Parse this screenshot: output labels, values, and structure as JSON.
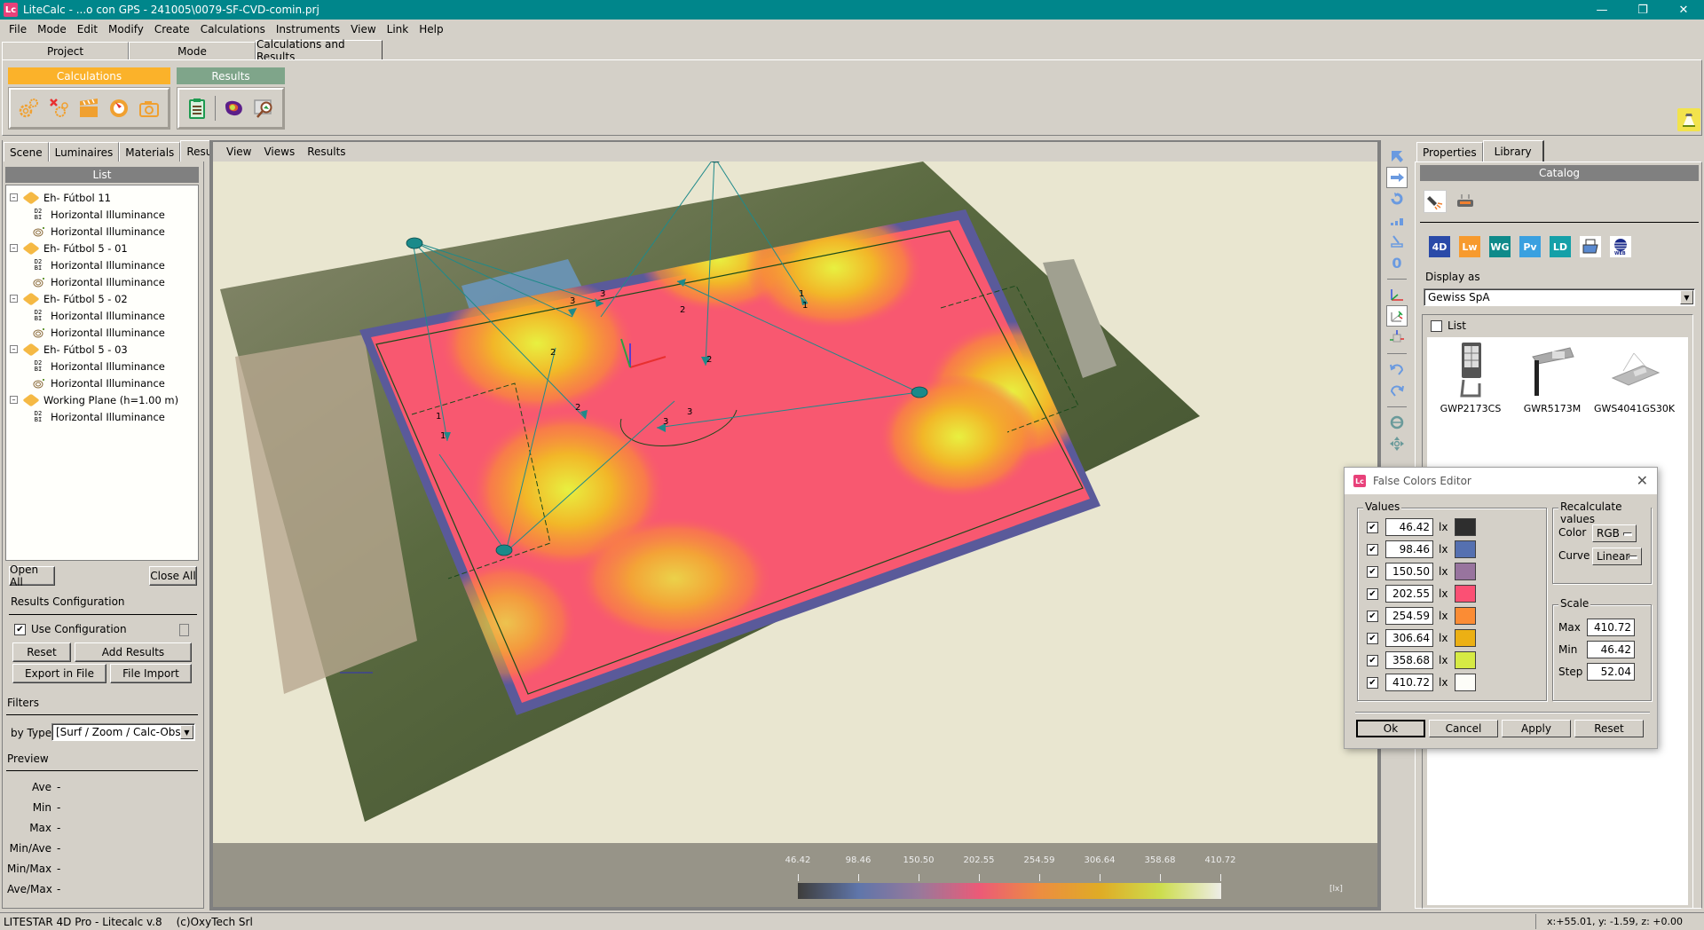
{
  "window": {
    "title": "LiteCalc - ...o con GPS - 241005\\0079-SF-CVD-comin.prj",
    "app_icon": "Lc",
    "controls": [
      "minimize",
      "restore",
      "close"
    ]
  },
  "menubar": [
    "File",
    "Mode",
    "Edit",
    "Modify",
    "Create",
    "Calculations",
    "Instruments",
    "View",
    "Link",
    "Help"
  ],
  "top_tabs": [
    {
      "label": "Project",
      "active": false
    },
    {
      "label": "Mode",
      "active": false
    },
    {
      "label": "Calculations and Results",
      "active": true
    }
  ],
  "ribbon": {
    "groups": [
      {
        "title": "Calculations",
        "color": "#fbb22a",
        "icons": [
          "calculate-gears-icon",
          "delete-calculation-icon",
          "clapperboard-icon",
          "compass-icon",
          "camera-icon"
        ]
      },
      {
        "title": "Results",
        "color": "#7fa58a",
        "icons": [
          "report-clipboard-icon",
          "false-color-icon",
          "image-zoom-icon"
        ]
      }
    ]
  },
  "left_panel": {
    "tabs": [
      {
        "label": "Scene",
        "active": false
      },
      {
        "label": "Luminaires",
        "active": false
      },
      {
        "label": "Materials",
        "active": false
      },
      {
        "label": "Results",
        "active": true
      }
    ],
    "list_header": "List",
    "tree": [
      {
        "label": "Eh- Fútbol 11",
        "children": [
          "Horizontal Illuminance",
          "Horizontal Illuminance"
        ]
      },
      {
        "label": "Eh- Fútbol 5 - 01",
        "children": [
          "Horizontal Illuminance",
          "Horizontal Illuminance"
        ]
      },
      {
        "label": "Eh- Fútbol 5 - 02",
        "children": [
          "Horizontal Illuminance",
          "Horizontal Illuminance"
        ]
      },
      {
        "label": "Eh- Fútbol 5 - 03",
        "children": [
          "Horizontal Illuminance",
          "Horizontal Illuminance"
        ]
      },
      {
        "label": "Working Plane (h=1.00 m)",
        "children": [
          "Horizontal Illuminance"
        ]
      }
    ],
    "open_all": "Open All",
    "close_all": "Close All",
    "results_config_label": "Results Configuration",
    "use_configuration": {
      "label": "Use Configuration",
      "checked": true
    },
    "reset": "Reset",
    "add_results": "Add Results",
    "export_in_file": "Export in File",
    "file_import": "File Import",
    "filters_label": "Filters",
    "by_type_label": "by Type",
    "by_type_value": "[Surf / Zoom / Calc-Obs]",
    "preview_label": "Preview",
    "preview": [
      {
        "label": "Ave",
        "value": "-"
      },
      {
        "label": "Min",
        "value": "-"
      },
      {
        "label": "Max",
        "value": "-"
      },
      {
        "label": "Min/Ave",
        "value": "-"
      },
      {
        "label": "Min/Max",
        "value": "-"
      },
      {
        "label": "Ave/Max",
        "value": "-"
      }
    ]
  },
  "viewport": {
    "menu": [
      "View",
      "Views",
      "Results"
    ],
    "aim_labels": [
      "3",
      "3",
      "2",
      "2",
      "2",
      "2",
      "3",
      "3",
      "1",
      "1",
      "1",
      "1"
    ],
    "legend": {
      "ticks": [
        "46.42",
        "98.46",
        "150.50",
        "202.55",
        "254.59",
        "306.64",
        "358.68",
        "410.72"
      ],
      "unit": "[lx]"
    }
  },
  "vertical_toolbar": [
    "select-arrow-icon",
    "move-icon",
    "rotate-icon",
    "scale-icon",
    "aim-icon",
    "zero-icon",
    "axes-icon",
    "view-axes-icon",
    "cube-axes-icon",
    "undo-icon",
    "redo-icon",
    "orbit-icon",
    "pan-icon"
  ],
  "right_panel": {
    "tabs": [
      {
        "label": "Properties",
        "active": false
      },
      {
        "label": "Library",
        "active": true
      }
    ],
    "catalog_header": "Catalog",
    "sources": [
      {
        "label": "4D",
        "bg": "#2a4aa8"
      },
      {
        "label": "Lw",
        "bg": "#f79a2e"
      },
      {
        "label": "WG",
        "bg": "#0e8a8a"
      },
      {
        "label": "Pv",
        "bg": "#3aa0e0"
      },
      {
        "label": "LD",
        "bg": "#15a0a8"
      }
    ],
    "display_as_label": "Display as",
    "display_as_value": "Gewiss SpA",
    "list_checkbox": {
      "label": "List",
      "checked": false
    },
    "luminaires": [
      "GWP2173CS",
      "GWR5173M",
      "GWS4041GS30K"
    ]
  },
  "false_colors_dialog": {
    "title": "False Colors Editor",
    "values_label": "Values",
    "unit": "lx",
    "rows": [
      {
        "checked": true,
        "value": "46.42",
        "color": "#2e2e2e"
      },
      {
        "checked": true,
        "value": "98.46",
        "color": "#5570b0"
      },
      {
        "checked": true,
        "value": "150.50",
        "color": "#98749e"
      },
      {
        "checked": true,
        "value": "202.55",
        "color": "#fb5074"
      },
      {
        "checked": true,
        "value": "254.59",
        "color": "#fb8c34"
      },
      {
        "checked": true,
        "value": "306.64",
        "color": "#ecb014"
      },
      {
        "checked": true,
        "value": "358.68",
        "color": "#d6ea44"
      },
      {
        "checked": true,
        "value": "410.72",
        "color": "#fdfdf8"
      }
    ],
    "recalculate_label": "Recalculate values",
    "color_label": "Color",
    "color_value": "RGB",
    "curve_label": "Curve",
    "curve_value": "Linear",
    "scale_label": "Scale",
    "max_label": "Max",
    "max_value": "410.72",
    "min_label": "Min",
    "min_value": "46.42",
    "step_label": "Step",
    "step_value": "52.04",
    "buttons": {
      "ok": "Ok",
      "cancel": "Cancel",
      "apply": "Apply",
      "reset": "Reset"
    }
  },
  "statusbar": {
    "product": "LITESTAR 4D Pro - Litecalc v.8",
    "copyright": "(c)OxyTech Srl",
    "coords": "x:+55.01, y: -1.59, z: +0.00"
  }
}
